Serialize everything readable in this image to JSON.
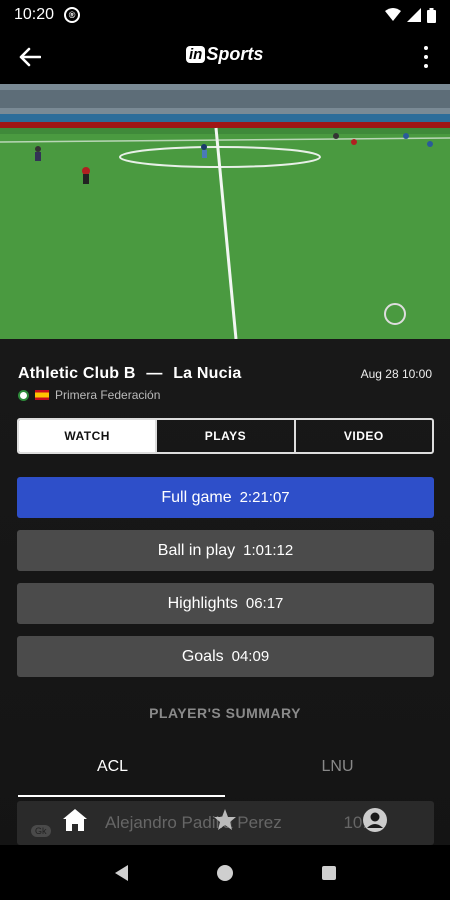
{
  "status_bar": {
    "time": "10:20"
  },
  "app_bar": {
    "logo_prefix": "in",
    "logo_text": "Sports"
  },
  "match": {
    "home_team": "Athletic Club B",
    "separator": "—",
    "away_team": "La Nucia",
    "date": "Aug 28 10:00",
    "league": "Primera Federación"
  },
  "tabs": [
    {
      "label": "WATCH"
    },
    {
      "label": "PLAYS"
    },
    {
      "label": "VIDEO"
    }
  ],
  "options": [
    {
      "label": "Full game",
      "duration": "2:21:07"
    },
    {
      "label": "Ball in play",
      "duration": "1:01:12"
    },
    {
      "label": "Highlights",
      "duration": "06:17"
    },
    {
      "label": "Goals",
      "duration": "04:09"
    }
  ],
  "players_summary": {
    "title": "PLAYER'S SUMMARY",
    "teams": [
      "ACL",
      "LNU"
    ],
    "rows": [
      {
        "badge": "Gk",
        "name": "Alejandro Padilla Perez",
        "number": "10:30"
      }
    ]
  },
  "colors": {
    "accent": "#2e4fc9",
    "option_bg": "#4b4b4b",
    "pitch": "#3f8a3a"
  },
  "icons": {
    "back": "arrow-left-icon",
    "menu": "more-vert-icon",
    "home": "home-icon",
    "favorites": "star-icon",
    "profile": "account-circle-icon"
  }
}
